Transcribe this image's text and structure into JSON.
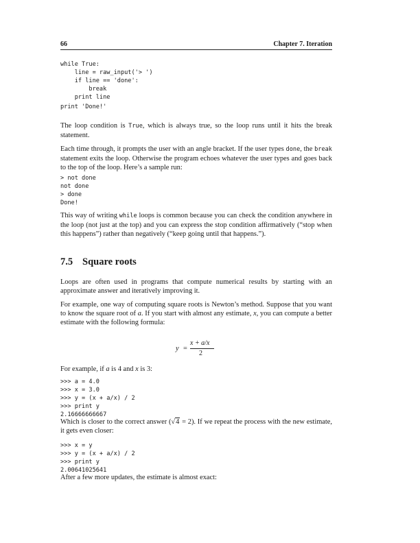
{
  "header": {
    "page_number": "66",
    "chapter": "Chapter 7.  Iteration"
  },
  "code1": "while True:\n    line = raw_input('> ')\n    if line == 'done':\n        break\n    print line",
  "code1_tail": "print 'Done!'",
  "p1": {
    "a": "The loop condition is ",
    "code": "True",
    "b": ", which is always true, so the loop runs until it hits the break statement."
  },
  "p2": {
    "a": "Each time through, it prompts the user with an angle bracket. If the user types ",
    "code1": "done",
    "b": ", the ",
    "code2": "break",
    "c": " statement exits the loop. Otherwise the program echoes whatever the user types and goes back to the top of the loop. Here’s a sample run:"
  },
  "code2": "> not done\nnot done\n> done\nDone!",
  "p3": {
    "a": "This way of writing ",
    "code": "while",
    "b": " loops is common because you can check the condition anywhere in the loop (not just at the top) and you can express the stop condition affirmatively (“stop when this happens”) rather than negatively (“keep going until that happens.”)."
  },
  "section": {
    "number": "7.5",
    "title": "Square roots"
  },
  "p4": "Loops are often used in programs that compute numerical results by starting with an approximate answer and iteratively improving it.",
  "p5": {
    "a": "For example, one way of computing square roots is Newton’s method. Suppose that you want to know the square root of ",
    "var_a": "a",
    "b": ". If you start with almost any estimate, ",
    "var_x": "x",
    "c": ", you can compute a better estimate with the following formula:"
  },
  "formula": {
    "lhs": "y",
    "eq": "=",
    "numerator": "x + a/x",
    "denominator": "2"
  },
  "p6": {
    "a": "For example, if ",
    "var_a": "a",
    "b": " is 4 and ",
    "var_x": "x",
    "c": " is 3:"
  },
  "code3": ">>> a = 4.0\n>>> x = 3.0\n>>> y = (x + a/x) / 2\n>>> print y\n2.16666666667",
  "p7": {
    "a": "Which is closer to the correct answer (",
    "sqrt_sym": "√",
    "radicand": "4",
    "eq": " = 2",
    "b": "). If we repeat the process with the new estimate, it gets even closer:"
  },
  "code4": ">>> x = y\n>>> y = (x + a/x) / 2\n>>> print y\n2.00641025641",
  "p8": "After a few more updates, the estimate is almost exact:"
}
